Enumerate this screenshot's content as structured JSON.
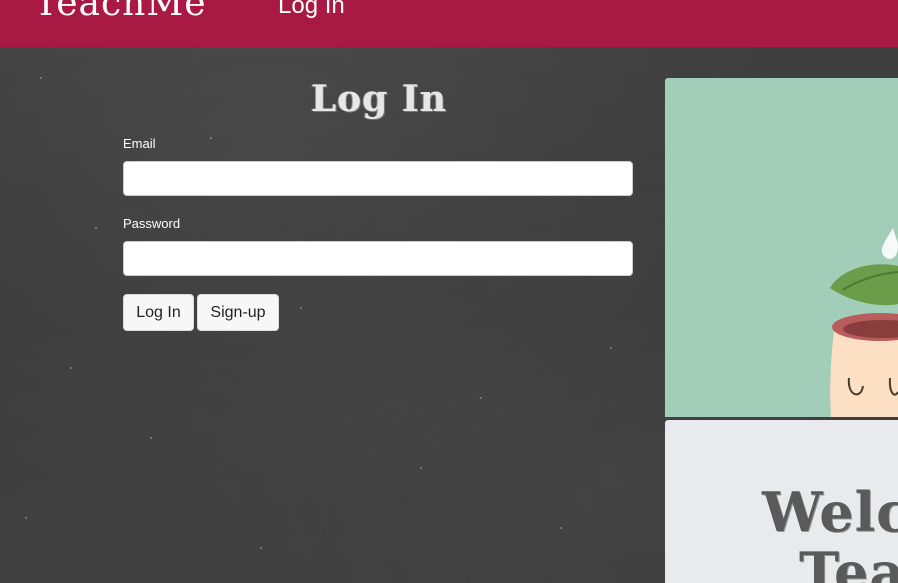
{
  "navbar": {
    "brand": "TeachMe",
    "login_link": "Log In"
  },
  "form": {
    "title": "Log In",
    "email_label": "Email",
    "email_value": "",
    "password_label": "Password",
    "password_value": "",
    "login_button": "Log In",
    "signup_button": "Sign-up"
  },
  "illustration": {
    "icon": "plant-pot-icon"
  },
  "welcome": {
    "line1": "Welco",
    "line2": "Tea"
  },
  "colors": {
    "navbar": "#a81a43",
    "illustration_bg": "#a2ceb9",
    "card_bg": "#e8eaed",
    "chalkboard": "#3b3b3b"
  }
}
